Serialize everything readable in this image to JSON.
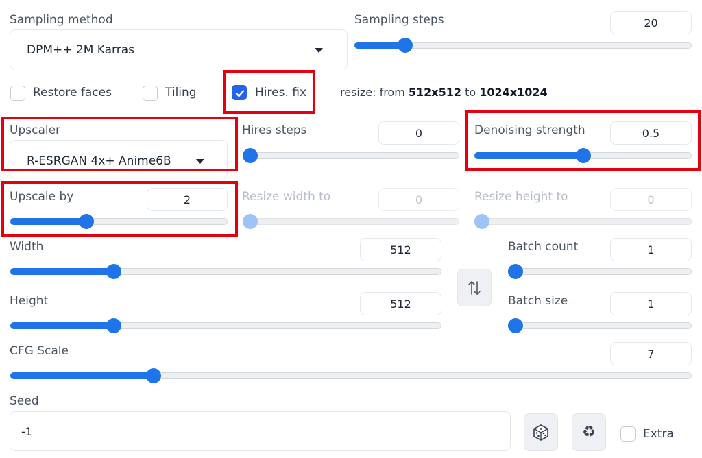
{
  "sampling": {
    "method_label": "Sampling method",
    "method_value": "DPM++ 2M Karras",
    "steps_label": "Sampling steps",
    "steps_value": "20",
    "steps_fraction": 0.15
  },
  "checkboxes": {
    "restore_faces": {
      "label": "Restore faces",
      "checked": false
    },
    "tiling": {
      "label": "Tiling",
      "checked": false
    },
    "hires_fix": {
      "label": "Hires. fix",
      "checked": true
    }
  },
  "resize_info": {
    "prefix": "resize: from",
    "from": "512x512",
    "middle": "to",
    "to": "1024x1024"
  },
  "hires": {
    "upscaler_label": "Upscaler",
    "upscaler_value": "R-ESRGAN 4x+ Anime6B",
    "steps_label": "Hires steps",
    "steps_value": "0",
    "steps_fraction": 0.0,
    "denoise_label": "Denoising strength",
    "denoise_value": "0.5",
    "denoise_fraction": 0.5,
    "upscale_by_label": "Upscale by",
    "upscale_by_value": "2",
    "upscale_by_fraction": 0.35,
    "resize_width_label": "Resize width to",
    "resize_width_value": "0",
    "resize_width_fraction": 0.0,
    "resize_height_label": "Resize height to",
    "resize_height_value": "0",
    "resize_height_fraction": 0.0
  },
  "dimensions": {
    "width_label": "Width",
    "width_value": "512",
    "width_fraction": 0.24,
    "height_label": "Height",
    "height_value": "512",
    "height_fraction": 0.24,
    "swap_icon": "swap-vertical-icon"
  },
  "batch": {
    "count_label": "Batch count",
    "count_value": "1",
    "count_fraction": 0.0,
    "size_label": "Batch size",
    "size_value": "1",
    "size_fraction": 0.0
  },
  "cfg": {
    "label": "CFG Scale",
    "value": "7",
    "fraction": 0.21
  },
  "seed": {
    "label": "Seed",
    "value": "-1",
    "dice_icon": "dice-icon",
    "recycle_icon": "recycle-icon",
    "extra_label": "Extra",
    "extra_checked": false
  },
  "colors": {
    "accent": "#1e74e8",
    "highlight_box": "#e3000f",
    "checkbox_checked": "#2563eb"
  }
}
